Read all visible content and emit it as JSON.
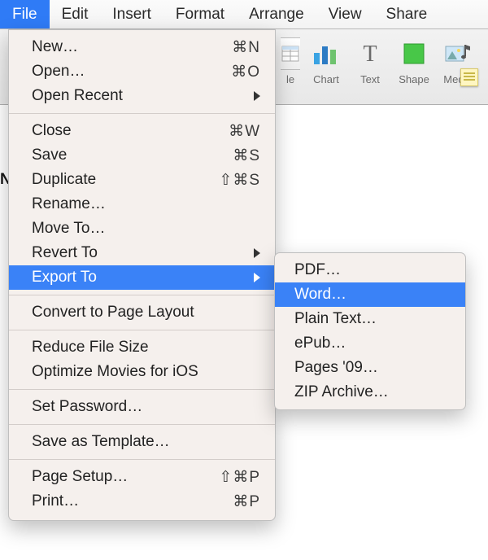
{
  "menubar": {
    "items": [
      {
        "label": "File",
        "active": true
      },
      {
        "label": "Edit"
      },
      {
        "label": "Insert"
      },
      {
        "label": "Format"
      },
      {
        "label": "Arrange"
      },
      {
        "label": "View"
      },
      {
        "label": "Share"
      }
    ]
  },
  "toolbar": {
    "tools": [
      {
        "name": "table-cutoff",
        "label": "le"
      },
      {
        "name": "chart",
        "label": "Chart"
      },
      {
        "name": "text",
        "label": "Text"
      },
      {
        "name": "shape",
        "label": "Shape"
      },
      {
        "name": "media",
        "label": "Media"
      }
    ]
  },
  "fileMenu": {
    "groups": [
      [
        {
          "label": "New…",
          "shortcut": "⌘N"
        },
        {
          "label": "Open…",
          "shortcut": "⌘O"
        },
        {
          "label": "Open Recent",
          "submenu": true
        }
      ],
      [
        {
          "label": "Close",
          "shortcut": "⌘W"
        },
        {
          "label": "Save",
          "shortcut": "⌘S"
        },
        {
          "label": "Duplicate",
          "shortcut": "⇧⌘S"
        },
        {
          "label": "Rename…"
        },
        {
          "label": "Move To…"
        },
        {
          "label": "Revert To",
          "submenu": true
        },
        {
          "label": "Export To",
          "submenu": true,
          "highlight": true
        }
      ],
      [
        {
          "label": "Convert to Page Layout"
        }
      ],
      [
        {
          "label": "Reduce File Size"
        },
        {
          "label": "Optimize Movies for iOS"
        }
      ],
      [
        {
          "label": "Set Password…"
        }
      ],
      [
        {
          "label": "Save as Template…"
        }
      ],
      [
        {
          "label": "Page Setup…",
          "shortcut": "⇧⌘P"
        },
        {
          "label": "Print…",
          "shortcut": "⌘P"
        }
      ]
    ]
  },
  "exportSubmenu": {
    "items": [
      {
        "label": "PDF…"
      },
      {
        "label": "Word…",
        "highlight": true
      },
      {
        "label": "Plain Text…"
      },
      {
        "label": "ePub…"
      },
      {
        "label": "Pages '09…"
      },
      {
        "label": "ZIP Archive…"
      }
    ]
  },
  "fragments": {
    "ne": "Ne"
  }
}
